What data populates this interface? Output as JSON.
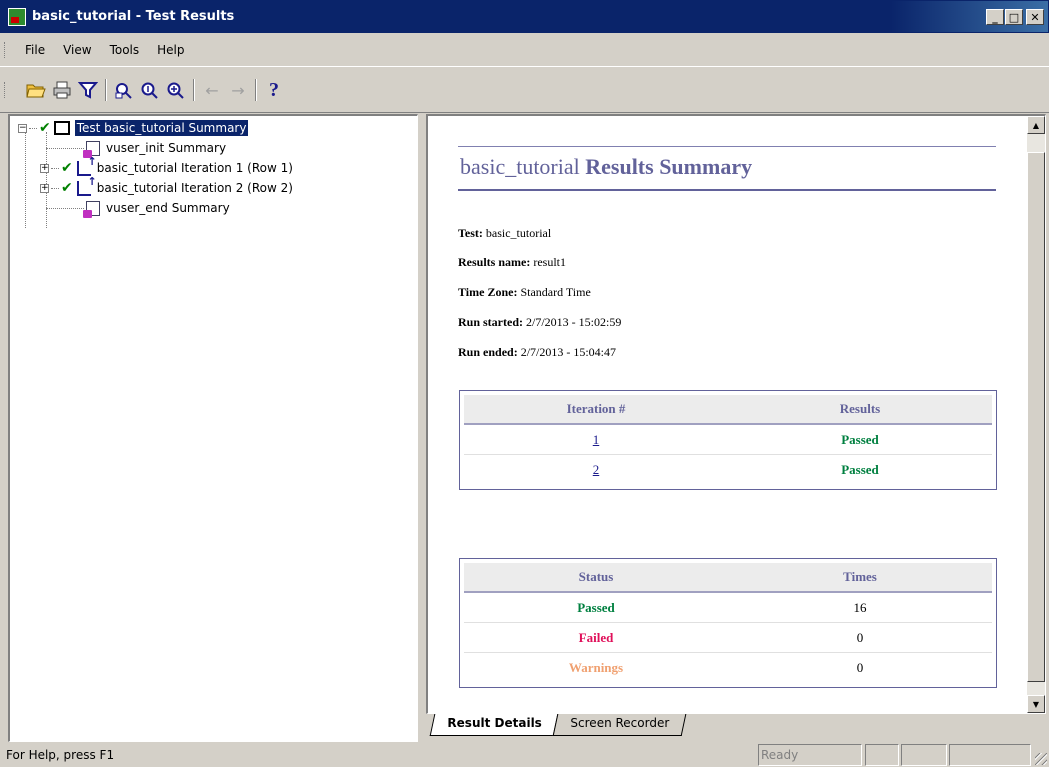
{
  "window": {
    "title": "basic_tutorial - Test Results",
    "minimize_label": "_",
    "maximize_label": "□",
    "close_label": "✕"
  },
  "menu": {
    "items": [
      {
        "label": "File"
      },
      {
        "label": "View"
      },
      {
        "label": "Tools"
      },
      {
        "label": "Help"
      }
    ]
  },
  "toolbar": {
    "icons": [
      "open-folder-icon",
      "print-icon",
      "filter-icon",
      "find-icon",
      "zoom-in-icon",
      "zoom-out-icon",
      "back-arrow-icon",
      "forward-arrow-icon",
      "help-icon"
    ],
    "help_glyph": "?"
  },
  "tree": {
    "root": "Test basic_tutorial Summary",
    "children": [
      {
        "label": "vuser_init Summary"
      },
      {
        "label": "basic_tutorial Iteration 1 (Row 1)"
      },
      {
        "label": "basic_tutorial Iteration 2 (Row 2)"
      },
      {
        "label": "vuser_end Summary"
      }
    ]
  },
  "report": {
    "title_normal": "basic_tutorial",
    "title_bold": "Results Summary",
    "info": [
      {
        "label": "Test:",
        "value": "basic_tutorial"
      },
      {
        "label": "Results name:",
        "value": "result1"
      },
      {
        "label": "Time Zone:",
        "value": "Standard Time"
      },
      {
        "label": "Run started:",
        "value": "2/7/2013 - 15:02:59"
      },
      {
        "label": "Run ended:",
        "value": "2/7/2013 - 15:04:47"
      }
    ],
    "iterations_table": {
      "headers": [
        "Iteration #",
        "Results"
      ],
      "rows": [
        {
          "iteration": "1",
          "result": "Passed"
        },
        {
          "iteration": "2",
          "result": "Passed"
        }
      ]
    },
    "status_table": {
      "headers": [
        "Status",
        "Times"
      ],
      "rows": [
        {
          "status": "Passed",
          "times": "16"
        },
        {
          "status": "Failed",
          "times": "0"
        },
        {
          "status": "Warnings",
          "times": "0"
        }
      ]
    }
  },
  "tabs": [
    {
      "label": "Result Details",
      "active": true
    },
    {
      "label": "Screen Recorder",
      "active": false
    }
  ],
  "statusbar": {
    "help_text": "For Help, press F1",
    "state": "Ready"
  },
  "colors": {
    "title_bar": "#0a246a",
    "report_accent": "#62629a",
    "passed": "#008040",
    "failed": "#e0105a",
    "warnings": "#f0a070"
  }
}
